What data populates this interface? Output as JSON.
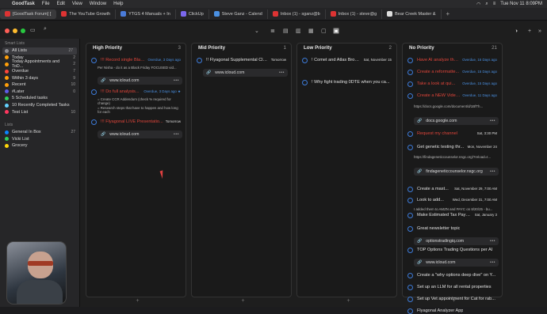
{
  "menubar": {
    "app": "GoodTask",
    "items": [
      "File",
      "Edit",
      "View",
      "Window",
      "Help"
    ],
    "clock": "Tue Nov 11  8:09PM"
  },
  "tabs": [
    {
      "label": "[GoodTask Forum] [",
      "color": "#d33"
    },
    {
      "label": "The YouTube Growth",
      "color": "#d33"
    },
    {
      "label": "YTGS 4 Manuals + In",
      "color": "#4a7bd9"
    },
    {
      "label": "ClickUp",
      "color": "#7b68ee"
    },
    {
      "label": "Steve Ganz - Calend",
      "color": "#4a90e2"
    },
    {
      "label": "Inbox (1) - sganz@b",
      "color": "#d33"
    },
    {
      "label": "Inbox (1) - steve@g",
      "color": "#d33"
    },
    {
      "label": "Bear Creek Master &",
      "color": "#ddd"
    }
  ],
  "sidebar": {
    "smart_header": "Smart Lists",
    "smart": [
      {
        "label": "All Lists",
        "count": "27",
        "color": "#8e8e93"
      },
      {
        "label": "Today",
        "count": "2",
        "color": "#ff9f0a"
      },
      {
        "label": "Today Appointments and ToD...",
        "count": "2",
        "color": "#ff9f0a"
      },
      {
        "label": "Overdue",
        "count": "7",
        "color": "#ff453a"
      },
      {
        "label": "Within 3 days",
        "count": "9",
        "color": "#ff9f0a"
      },
      {
        "label": "Recent",
        "count": "10",
        "color": "#ff9f0a"
      },
      {
        "label": "#Later",
        "count": "0",
        "color": "#5e5ce6"
      },
      {
        "label": "5 Scheduled tasks",
        "count": "",
        "color": "#30d158"
      },
      {
        "label": "10 Recently Completed Tasks",
        "count": "",
        "color": "#64d2ff"
      },
      {
        "label": "Test List",
        "count": "10",
        "color": "#ff375f"
      }
    ],
    "lists_header": "Lists",
    "lists": [
      {
        "label": "General In Box",
        "count": "27",
        "color": "#0a84ff"
      },
      {
        "label": "Vicki List",
        "count": "",
        "color": "#30d158"
      },
      {
        "label": "Grocery",
        "count": "",
        "color": "#ffd60a"
      }
    ]
  },
  "columns": [
    {
      "name": "High Priority",
      "count": "3"
    },
    {
      "name": "Mid Priority",
      "count": "1"
    },
    {
      "name": "Low Priority",
      "count": "2"
    },
    {
      "name": "No Priority",
      "count": "21"
    }
  ],
  "high": [
    {
      "title": "!!! Record single Blac...",
      "due": "Overdue, 3 Days ago",
      "note": "Per Nisha - do it as a Black Friday FOCUSED vid...",
      "link": "www.icloud.com"
    },
    {
      "title": "!!! Do full analysis...",
      "due": "Overdue, 3 Days ago ★",
      "note": "= Create CCR Addendum (check % required for change)\n= Research steps that have to happen and how long for each"
    },
    {
      "title": "!!! Flyagonal LIVE Presentatio...",
      "due": "Tomorrow",
      "link": "www.icloud.com"
    }
  ],
  "mid": [
    {
      "title": "!! Flyagonal Supplemental Cla...",
      "due": "Tomorrow",
      "link": "www.icloud.com"
    }
  ],
  "low": [
    {
      "title": "! Comet and Atlas Brow...",
      "due": "Sat, November 15"
    },
    {
      "title": "! Why fight trading 0DTE when you ca..."
    }
  ],
  "nopri": [
    {
      "title": "Have AI analyze the...",
      "due": "Overdue, 16 Days ago",
      "red": true
    },
    {
      "title": "Create a reformatte...",
      "due": "Overdue, 15 Days ago",
      "red": true
    },
    {
      "title": "Take a look at qui...",
      "due": "Overdue, 15 Days ago",
      "red": true
    },
    {
      "title": "Create a NEW Video -...",
      "due": "Overdue, 11 Days ago",
      "red": true,
      "note": "https://docs.google.com/document/d/1BfTh...",
      "link": "docs.google.com"
    },
    {
      "title": "Request my channel",
      "due": "Sat, 3:30 PM",
      "red": true
    },
    {
      "title": "Get genetic testing thr...",
      "due": "Mon, November 24",
      "note": "https://findageneticcounselor.nsgc.org/?reload=t...",
      "link": "findageneticcounselor.nsgc.org"
    },
    {
      "title": "Create a mast...",
      "due": "Sat, November 29, 7:00 AM"
    },
    {
      "title": "Look to add...",
      "due": "Wed, December 31, 7:00 AM",
      "note": "I added them to AMZN and PAYC on 8/20/25 - bu..."
    },
    {
      "title": "Make Estimated Tax Paym...",
      "due": "Sat, January 3"
    },
    {
      "title": "Great newsletter topic",
      "link": "optionstradingiq.com"
    },
    {
      "title": "TOP Options Trading Questions per AI",
      "link": "www.icloud.com"
    },
    {
      "title": "Create a \"why options deep dive\" on Y..."
    },
    {
      "title": "Set up an LLM for all rental properties"
    },
    {
      "title": "Set up Vet appointment for Cat for rab..."
    },
    {
      "title": "Flyagonal Analyzer App"
    }
  ]
}
